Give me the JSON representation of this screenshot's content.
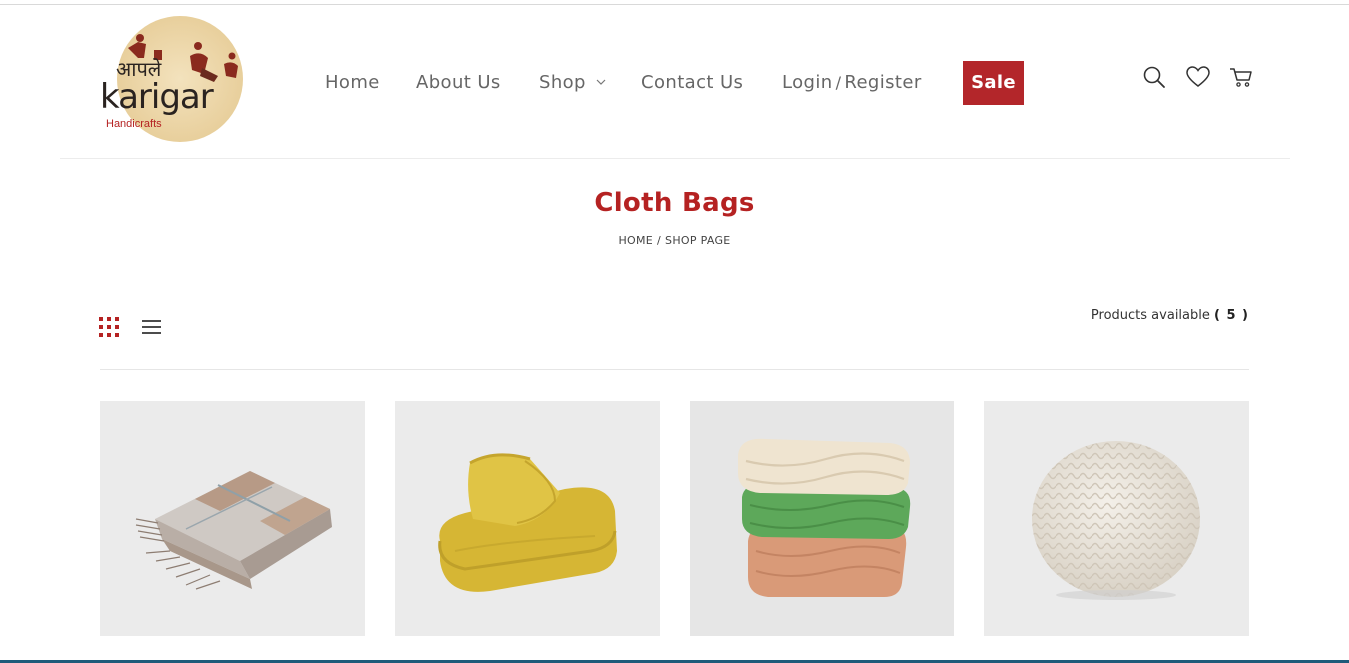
{
  "brand": {
    "logo_devanagari": "आपले",
    "logo_name": "karigar",
    "logo_tagline": "Handicrafts"
  },
  "nav": {
    "home": "Home",
    "about": "About Us",
    "shop": "Shop",
    "contact": "Contact Us",
    "login": "Login",
    "login_sep": "/",
    "register": "Register",
    "sale": "Sale"
  },
  "header_icons": [
    "search-icon",
    "heart-icon",
    "cart-icon"
  ],
  "page": {
    "title": "Cloth Bags",
    "breadcrumb_home": "HOME",
    "breadcrumb_sep": "/",
    "breadcrumb_current": "SHOP PAGE"
  },
  "toolbar": {
    "count_label": "Products available",
    "count_value": "( 5 )",
    "view_modes": [
      "grid-view-icon",
      "list-view-icon"
    ],
    "active_view": "grid"
  },
  "products": [
    {
      "image": "folded-plaid-throw-blanket"
    },
    {
      "image": "folded-yellow-knit-blanket"
    },
    {
      "image": "stack-of-cable-knit-blankets"
    },
    {
      "image": "knitted-pouf"
    }
  ],
  "colors": {
    "accent": "#b52222",
    "sale_bg": "#b3262a",
    "nav_text": "#666666",
    "card_bg": "#ebebeb"
  }
}
